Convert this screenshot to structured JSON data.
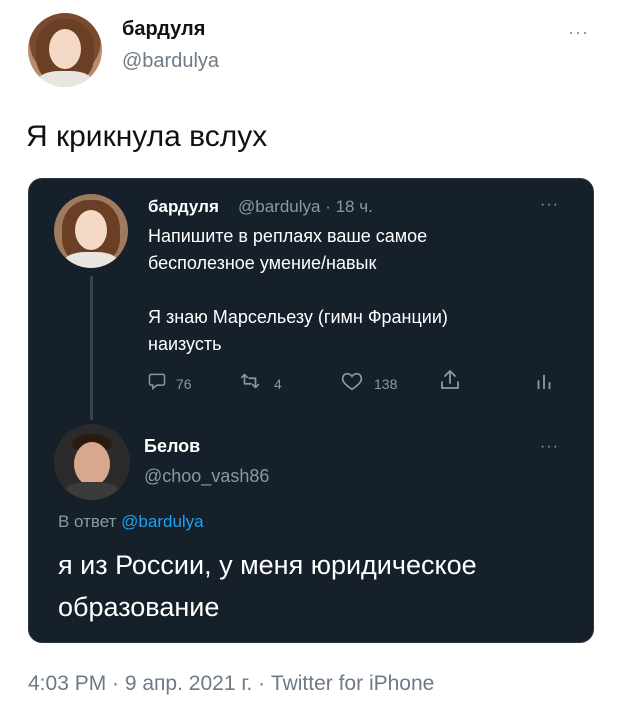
{
  "tweet": {
    "author_name": "бардуля",
    "author_handle": "@bardulya",
    "more": "···",
    "text": "Я крикнула вслух",
    "footer": "4:03 PM · 9 апр. 2021 г. · Twitter for iPhone"
  },
  "quoted": {
    "author_name": "бардуля",
    "meta": "@bardulya · 18 ч.",
    "more": "···",
    "text": "Напишите в реплаях ваше самое\nбесполезное умение/навык\n\nЯ знаю Марсельезу (гимн Франции)\nнаизусть",
    "actions": {
      "reply_count": "76",
      "retweet_count": "4",
      "like_count": "138"
    }
  },
  "reply": {
    "author_name": "Белов",
    "author_handle": "@choo_vash86",
    "more": "···",
    "reply_to_prefix": "В ответ ",
    "reply_to_handle": "@bardulya",
    "text": "я из  России, у меня юридическое образование"
  },
  "icons": {
    "reply": "reply-icon",
    "retweet": "retweet-icon",
    "like": "heart-icon",
    "share": "share-icon",
    "analytics": "analytics-icon"
  }
}
